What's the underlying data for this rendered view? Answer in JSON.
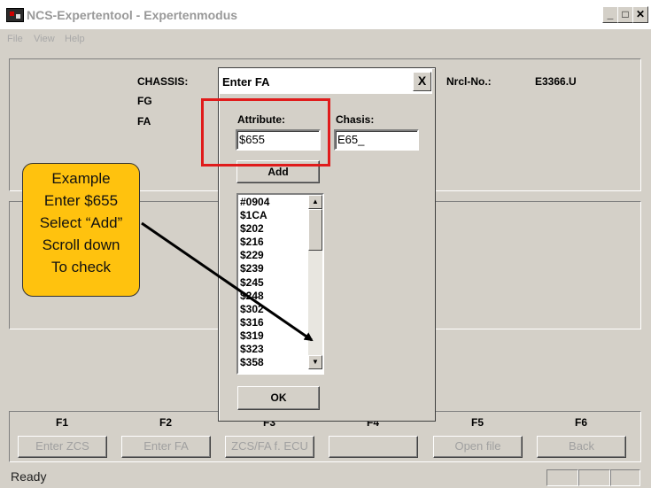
{
  "window": {
    "title": "NCS-Expertentool - Expertenmodus"
  },
  "menu": [
    "File",
    "View",
    "Help"
  ],
  "info": {
    "chassis_label": "CHASSIS:",
    "fg_label": "FG",
    "fa_label": "FA",
    "nrcl_label": "Nrcl-No.:",
    "nrcl_value": "E3366.U"
  },
  "dialog": {
    "title": "Enter FA",
    "close": "X",
    "attribute_label": "Attribute:",
    "attribute_value": "$655",
    "chasis_label": "Chasis:",
    "chasis_value": "E65_",
    "add_label": "Add",
    "ok_label": "OK",
    "list": [
      "#0904",
      "$1CA",
      "$202",
      "$216",
      "$229",
      "$239",
      "$245",
      "$248",
      "$302",
      "$316",
      "$319",
      "$323",
      "$358"
    ]
  },
  "callout": {
    "lines": [
      "Example",
      "Enter $655",
      "Select “Add”",
      "Scroll down",
      "To check"
    ]
  },
  "fkeys": [
    {
      "key": "F1",
      "label": "Enter ZCS"
    },
    {
      "key": "F2",
      "label": "Enter FA"
    },
    {
      "key": "F3",
      "label": "ZCS/FA f. ECU"
    },
    {
      "key": "F4",
      "label": ""
    },
    {
      "key": "F5",
      "label": "Open file"
    },
    {
      "key": "F6",
      "label": "Back"
    }
  ],
  "status": {
    "text": "Ready"
  },
  "colors": {
    "highlight": "#e01b1b",
    "callout_fill": "#ffc20e"
  }
}
